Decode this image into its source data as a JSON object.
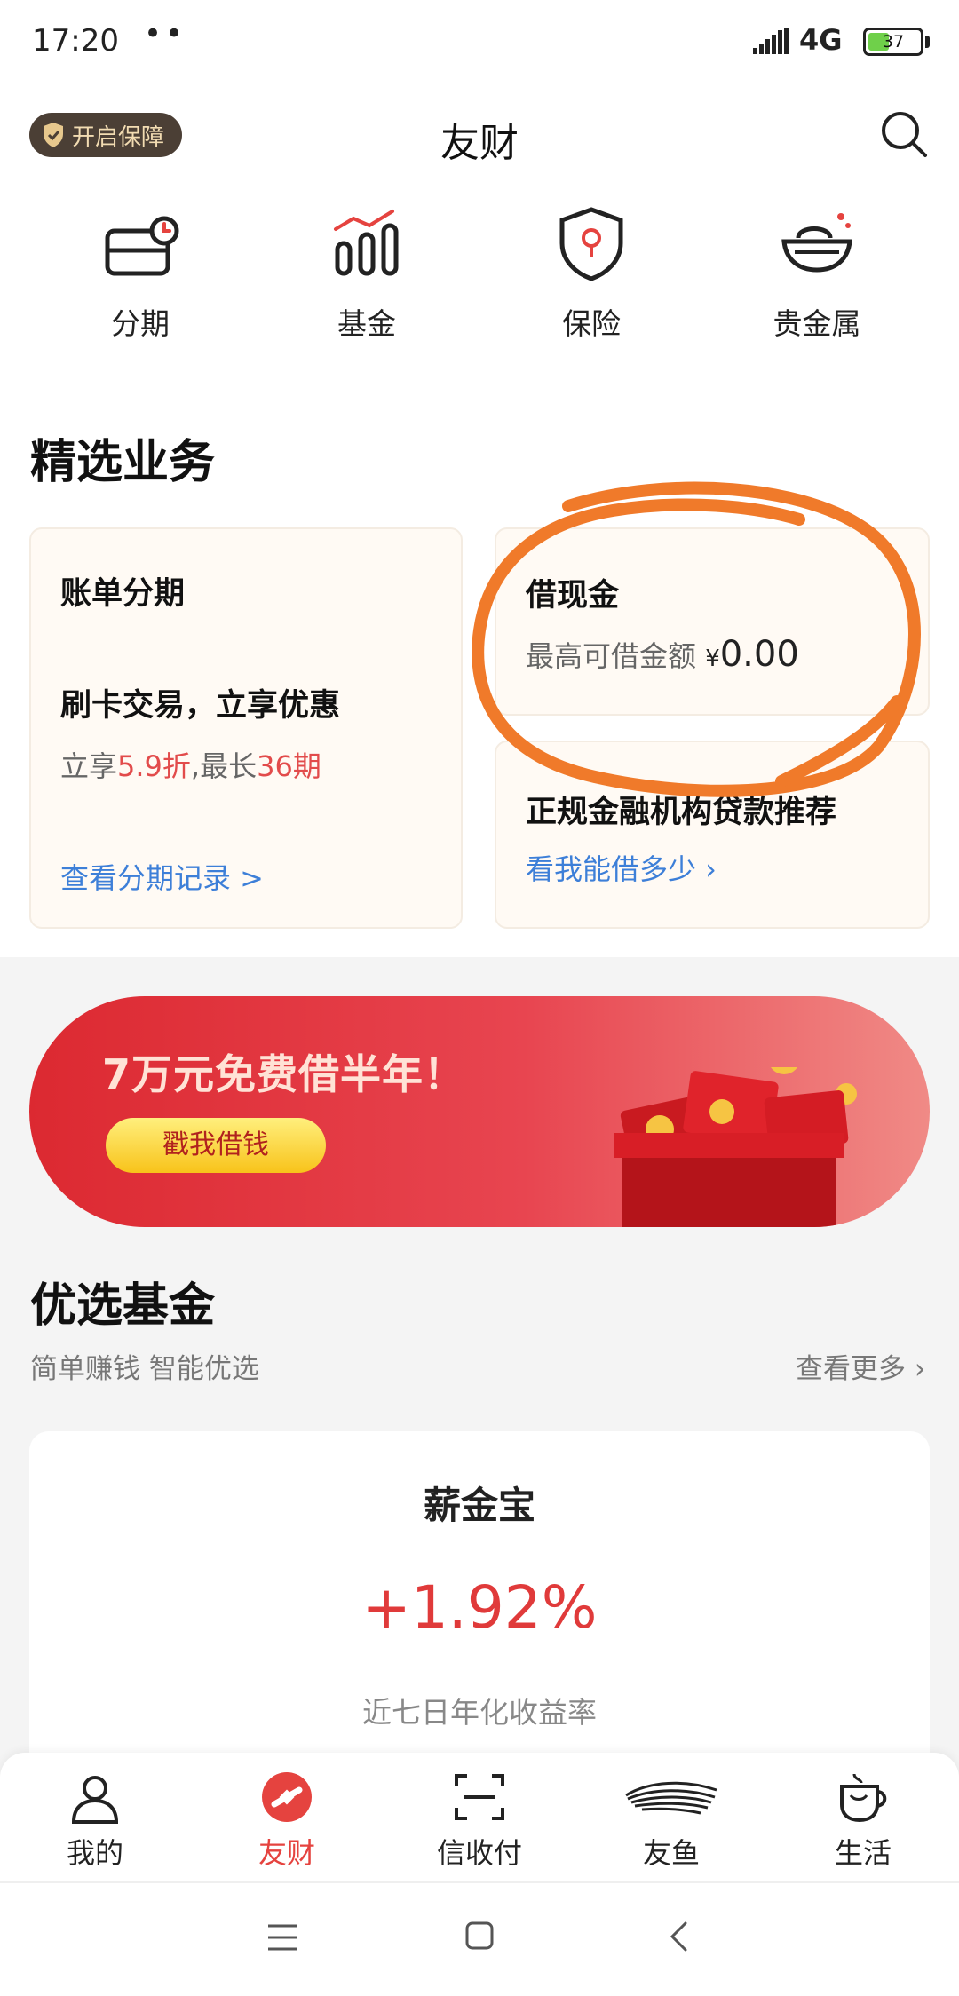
{
  "status_bar": {
    "time": "17:20",
    "dots": "••",
    "network": "4G",
    "battery": "37"
  },
  "header": {
    "protect_label": "开启保障",
    "title": "友财"
  },
  "quick_actions": [
    {
      "label": "分期",
      "icon": "installment-card-icon"
    },
    {
      "label": "基金",
      "icon": "fund-chart-icon"
    },
    {
      "label": "保险",
      "icon": "insurance-shield-icon"
    },
    {
      "label": "贵金属",
      "icon": "gold-ingot-icon"
    }
  ],
  "featured": {
    "title": "精选业务",
    "installment": {
      "title": "账单分期",
      "headline": "刷卡交易，立享优惠",
      "promo_prefix": "立享",
      "promo_discount": "5.9折",
      "promo_mid": ",最长",
      "promo_periods": "36期",
      "link": "查看分期记录 >"
    },
    "cash": {
      "title": "借现金",
      "limit_label": "最高可借金额",
      "currency": "¥",
      "amount": "0.00"
    },
    "loan": {
      "title": "正规金融机构贷款推荐",
      "link": "看我能借多少 ›"
    }
  },
  "banner": {
    "title": "7万元免费借半年！",
    "button": "戳我借钱"
  },
  "funds": {
    "title": "优选基金",
    "subtitle": "简单赚钱 智能优选",
    "more": "查看更多 ›",
    "card": {
      "name": "薪金宝",
      "rate": "+1.92%",
      "rate_label": "近七日年化收益率"
    }
  },
  "bottom_nav": [
    {
      "label": "我的",
      "icon": "person-icon",
      "active": false
    },
    {
      "label": "友财",
      "icon": "youcai-logo-icon",
      "active": true
    },
    {
      "label": "信收付",
      "icon": "scan-icon",
      "active": false
    },
    {
      "label": "友鱼",
      "icon": "fish-icon",
      "active": false
    },
    {
      "label": "生活",
      "icon": "coffee-cup-icon",
      "active": false
    }
  ],
  "colors": {
    "accent_red": "#e5433f",
    "link_blue": "#3d7fd8",
    "annotation_orange": "#f07a2a"
  }
}
